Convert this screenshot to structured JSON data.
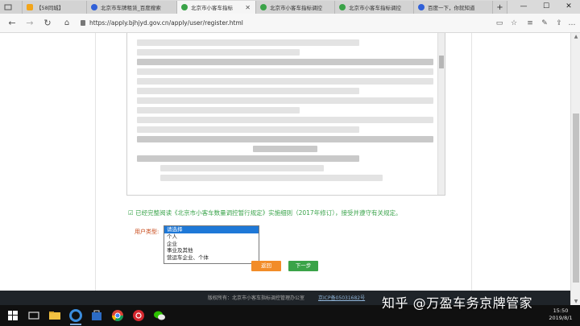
{
  "browser": {
    "tabs": [
      {
        "label": "【58同城】",
        "active": false,
        "icon": "58-favicon"
      },
      {
        "label": "北京市车牌租赁_百度搜索",
        "active": false,
        "icon": "baidu-favicon"
      },
      {
        "label": "北京市小客车指标",
        "active": true,
        "icon": "site-favicon"
      },
      {
        "label": "北京市小客车指标调控",
        "active": false,
        "icon": "site-favicon"
      },
      {
        "label": "北京市小客车指标调控",
        "active": false,
        "icon": "site-favicon"
      },
      {
        "label": "百度一下，你就知道",
        "active": false,
        "icon": "baidu-favicon"
      }
    ],
    "window_controls": [
      "—",
      "☐",
      "✕"
    ],
    "nav": {
      "back": "←",
      "forward": "→",
      "refresh": "↻"
    },
    "url": "https://apply.bjhjyd.gov.cn/apply/user/register.html"
  },
  "form": {
    "agree_text": "☑ 已经完整阅读《北京市小客车数量调控暂行规定》实施细则（2017年修订），接受并遵守有关规定。",
    "user_type_label": "用户类型:",
    "user_type_options": [
      "请选择",
      "个人",
      "企业",
      "事业及其他",
      "营运车企业、个体"
    ],
    "selected_option": "请选择",
    "back_button": "返回",
    "next_button": "下一步"
  },
  "footer": {
    "copyright": "版权所有：北京市小客车指标调控管理办公室",
    "icp": "京ICP备05031682号"
  },
  "watermark": "知乎 @万盈车务京牌管家",
  "taskbar": {
    "time": "15:50",
    "date": "2019/8/1"
  },
  "colors": {
    "accent_green": "#3aa348",
    "accent_orange": "#f28c28",
    "select_highlight": "#1e78d7",
    "agree_green": "#39a34a"
  }
}
